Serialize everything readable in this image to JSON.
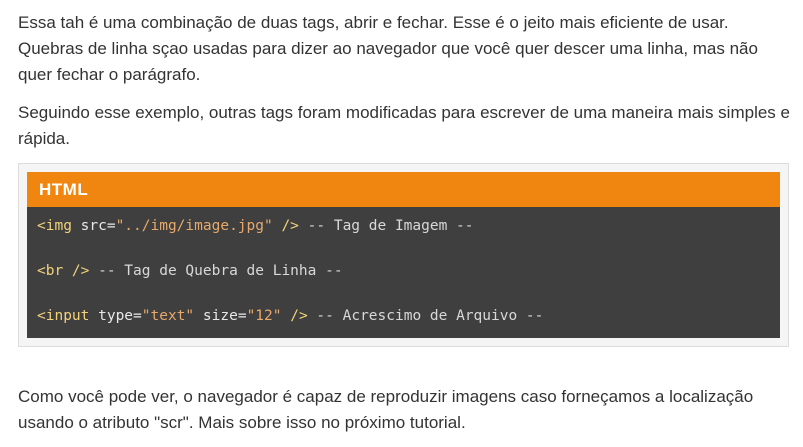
{
  "article": {
    "paragraph1": "Essa tah é uma combinação de duas tags, abrir e fechar. Esse é o jeito mais eficiente de usar. Quebras de linha sçao usadas para dizer ao navegador que você quer descer uma linha, mas não quer fechar o parágrafo.",
    "paragraph2": "Seguindo esse exemplo, outras tags foram modificadas para escrever de uma maneira mais simples e rápida.",
    "paragraph3": "Como você pode ver, o navegador é capaz de reproduzir imagens caso forneçamos a localização usando o atributo \"scr\". Mais sobre isso no próximo tutorial."
  },
  "code_block": {
    "language_label": "HTML",
    "lines": [
      {
        "tag_open": "<img",
        "attr1": " src=",
        "value1": "\"../img/image.jpg\"",
        "tag_close": " />",
        "comment": " -- Tag de Imagem --"
      },
      {
        "tag_full": "<br />",
        "comment": " -- Tag de Quebra de Linha --"
      },
      {
        "tag_open": "<input",
        "attr1": " type=",
        "value1": "\"text\"",
        "attr2": " size=",
        "value2": "\"12\"",
        "tag_close": " />",
        "comment": " -- Acrescimo de Arquivo --"
      }
    ]
  },
  "colors": {
    "header_bg": "#f0850f",
    "code_bg": "#3f3f3f",
    "tag_color": "#f2d27a",
    "string_color": "#e6a96b"
  }
}
